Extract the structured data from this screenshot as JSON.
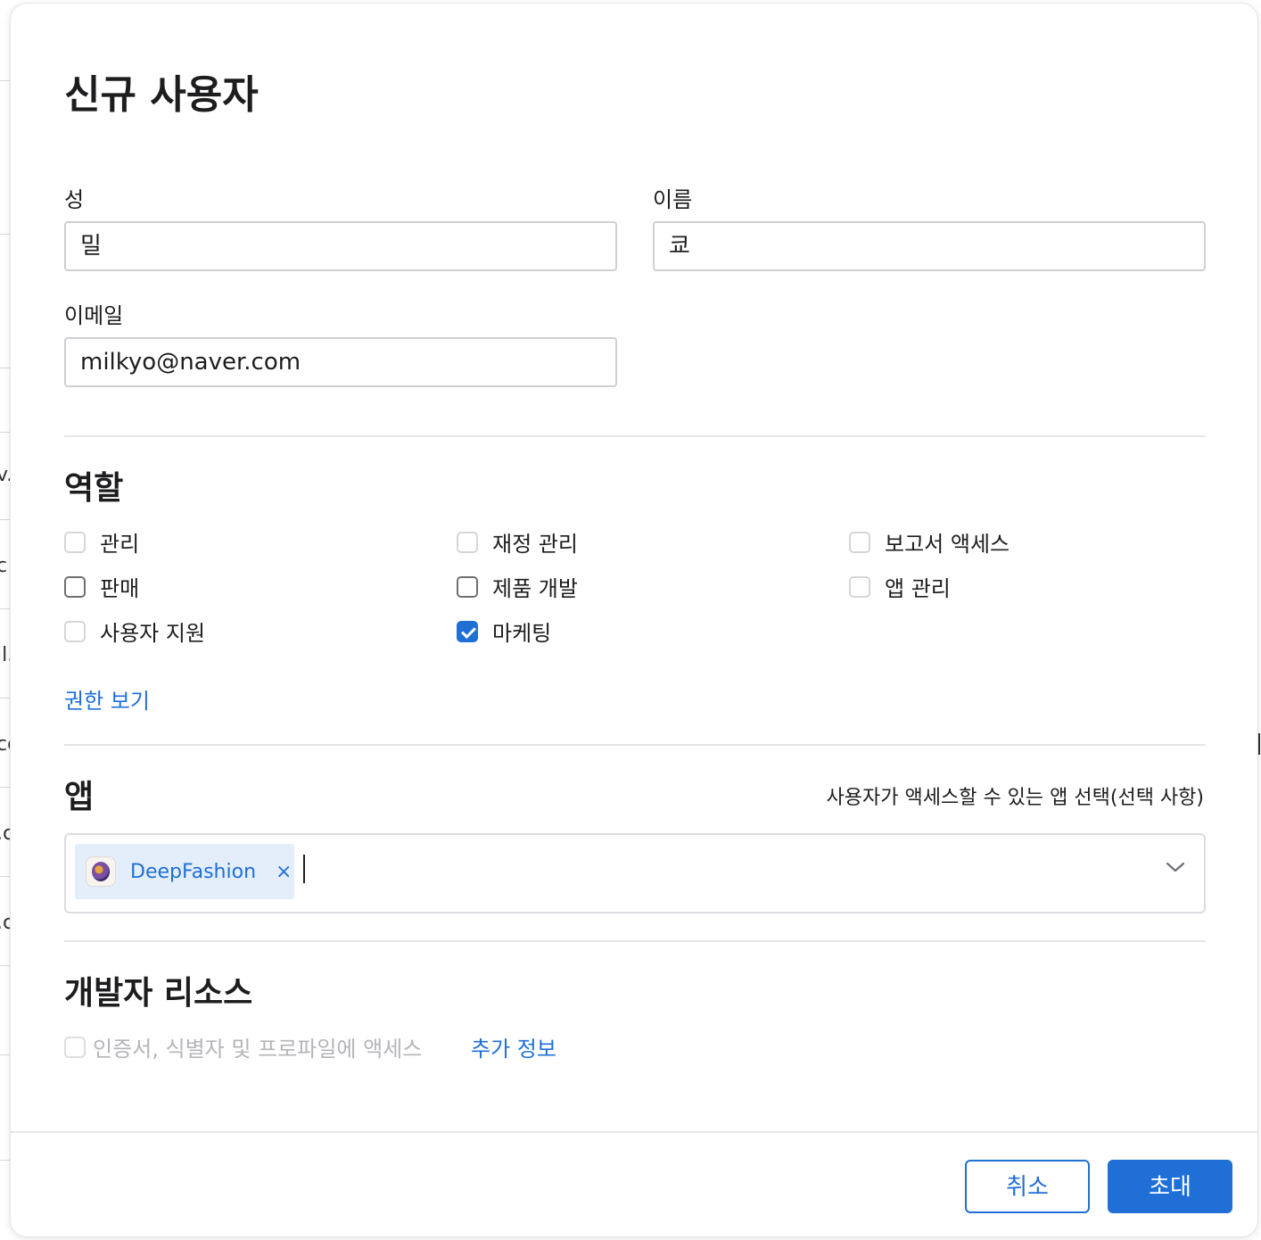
{
  "background": {
    "fragments": [
      "v.",
      "c",
      "il.",
      "co",
      ".c",
      ".c"
    ]
  },
  "modal": {
    "title": "신규 사용자",
    "fields": {
      "last_name": {
        "label": "성",
        "value": "밀"
      },
      "first_name": {
        "label": "이름",
        "value": "쿄"
      },
      "email": {
        "label": "이메일",
        "value": "milkyo@naver.com"
      }
    },
    "roles": {
      "title": "역할",
      "items": [
        {
          "label": "관리",
          "checked": false
        },
        {
          "label": "재정 관리",
          "checked": false
        },
        {
          "label": "보고서 액세스",
          "checked": false
        },
        {
          "label": "판매",
          "checked": false
        },
        {
          "label": "제품 개발",
          "checked": false
        },
        {
          "label": "앱 관리",
          "checked": false
        },
        {
          "label": "사용자 지원",
          "checked": false
        },
        {
          "label": "마케팅",
          "checked": true
        }
      ],
      "permissions_link": "권한 보기"
    },
    "apps": {
      "title": "앱",
      "hint": "사용자가 액세스할 수 있는 앱 선택(선택 사항)",
      "selected": [
        {
          "name": "DeepFashion",
          "icon": "deepfashion-app-icon"
        }
      ],
      "remove_glyph": "×"
    },
    "developer_resources": {
      "title": "개발자 리소스",
      "checkbox_label": "인증서, 식별자 및 프로파일에 액세스",
      "more_info_link": "추가 정보"
    },
    "buttons": {
      "cancel": "취소",
      "invite": "초대"
    }
  },
  "colors": {
    "accent": "#1f6fd6",
    "chip_bg": "#e4eefb",
    "disabled_text": "#b5b5ba"
  }
}
